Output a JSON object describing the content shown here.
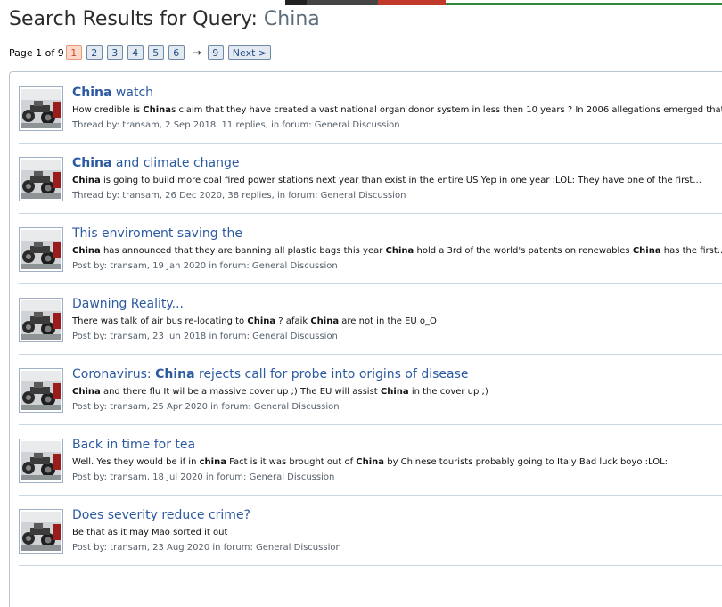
{
  "page": {
    "heading_prefix": "Search Results for Query: ",
    "query": "China"
  },
  "pagination": {
    "info": "Page 1 of 9",
    "pages": [
      "1",
      "2",
      "3",
      "4",
      "5",
      "6"
    ],
    "current": "1",
    "arrow": "→",
    "last": "9",
    "next_label": "Next >"
  },
  "results": [
    {
      "title_parts": [
        {
          "t": "China",
          "hl": true
        },
        {
          "t": " watch",
          "hl": false
        }
      ],
      "snippet_parts": [
        {
          "t": "How credible is ",
          "b": false
        },
        {
          "t": "China",
          "b": true
        },
        {
          "t": "s claim that they have created a vast national organ donor system in less then 10 years ? In 2006 allegations emerged that...",
          "b": false
        }
      ],
      "meta": "Thread by: transam, 2 Sep 2018, 11 replies, in forum: General Discussion"
    },
    {
      "title_parts": [
        {
          "t": "China",
          "hl": true
        },
        {
          "t": " and climate change",
          "hl": false
        }
      ],
      "snippet_parts": [
        {
          "t": "China",
          "b": true
        },
        {
          "t": " is going to build more coal fired power stations next year than exist in the entire US Yep in one year :LOL: They have one of the first...",
          "b": false
        }
      ],
      "meta": "Thread by: transam, 26 Dec 2020, 38 replies, in forum: General Discussion"
    },
    {
      "title_parts": [
        {
          "t": "This enviroment saving the",
          "hl": false
        }
      ],
      "snippet_parts": [
        {
          "t": "China",
          "b": true
        },
        {
          "t": " has announced that they are banning all plastic bags this year ",
          "b": false
        },
        {
          "t": "China",
          "b": true
        },
        {
          "t": " hold a 3rd of the world's patents on renewables ",
          "b": false
        },
        {
          "t": "China",
          "b": true
        },
        {
          "t": " has the first...",
          "b": false
        }
      ],
      "meta": "Post by: transam, 19 Jan 2020 in forum: General Discussion"
    },
    {
      "title_parts": [
        {
          "t": "Dawning Reality...",
          "hl": false
        }
      ],
      "snippet_parts": [
        {
          "t": "There was talk of air bus re-locating to ",
          "b": false
        },
        {
          "t": "China",
          "b": true
        },
        {
          "t": " ? afaik ",
          "b": false
        },
        {
          "t": "China",
          "b": true
        },
        {
          "t": " are not in the EU o_O",
          "b": false
        }
      ],
      "meta": "Post by: transam, 23 Jun 2018 in forum: General Discussion"
    },
    {
      "title_parts": [
        {
          "t": "Coronavirus: ",
          "hl": false
        },
        {
          "t": "China",
          "hl": true
        },
        {
          "t": " rejects call for probe into origins of disease",
          "hl": false
        }
      ],
      "snippet_parts": [
        {
          "t": "China",
          "b": true
        },
        {
          "t": " and there flu It wil be a massive cover up ;) The EU will assist ",
          "b": false
        },
        {
          "t": "China",
          "b": true
        },
        {
          "t": " in the cover up ;)",
          "b": false
        }
      ],
      "meta": "Post by: transam, 25 Apr 2020 in forum: General Discussion"
    },
    {
      "title_parts": [
        {
          "t": "Back in time for tea",
          "hl": false
        }
      ],
      "snippet_parts": [
        {
          "t": "Well. Yes they would be if in ",
          "b": false
        },
        {
          "t": "china",
          "b": true
        },
        {
          "t": " Fact is it was brought out of ",
          "b": false
        },
        {
          "t": "China",
          "b": true
        },
        {
          "t": " by Chinese tourists probably going to Italy Bad luck boyo :LOL:",
          "b": false
        }
      ],
      "meta": "Post by: transam, 18 Jul 2020 in forum: General Discussion"
    },
    {
      "title_parts": [
        {
          "t": "Does severity reduce crime?",
          "hl": false
        }
      ],
      "snippet_parts": [
        {
          "t": "Be that as it may Mao sorted it out",
          "b": false
        }
      ],
      "meta": "Post by: transam, 23 Aug 2020 in forum: General Discussion"
    }
  ]
}
